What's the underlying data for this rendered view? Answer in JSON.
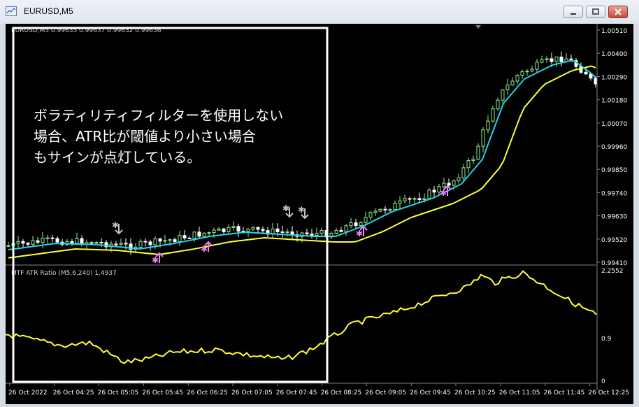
{
  "window": {
    "title": "EURUSD,M5"
  },
  "main_chart": {
    "header": "EURUSD,M5  0.99635 0.99637 0.99632 0.99636",
    "price_ticks": [
      "1.00510",
      "1.00400",
      "1.00290",
      "1.00180",
      "1.00070",
      "0.99960",
      "0.99850",
      "0.99740",
      "0.99630",
      "0.99520",
      "0.99410"
    ]
  },
  "indicator": {
    "label": "MTF ATR Ratio",
    "params": "(M5,6,240)",
    "value": "1.4937",
    "ticks": [
      "2.2552",
      "0.9",
      "0"
    ]
  },
  "time_labels": [
    "26 Oct 2022",
    "26 Oct 04:25",
    "26 Oct 05:05",
    "26 Oct 05:45",
    "26 Oct 06:25",
    "26 Oct 07:05",
    "26 Oct 07:45",
    "26 Oct 08:25",
    "26 Oct 09:05",
    "26 Oct 09:45",
    "26 Oct 10:25",
    "26 Oct 11:05",
    "26 Oct 11:45",
    "26 Oct 12:25"
  ],
  "annotation": {
    "text": "ボラティリティフィルターを使用しない\n場合、ATR比が閾値より小さい場合\nもサインが点灯している。"
  },
  "colors": {
    "background": "#000000",
    "bull_candle": "#90ee90",
    "bear_candle": "#ffffff",
    "fast_ma": "#22d3ee",
    "slow_ma": "#ffff33",
    "atr_line": "#ffff33",
    "buy_arrow": "#ee82ee",
    "sell_arrow": "#c0c0c0",
    "highlight_box": "#ffffff"
  }
}
